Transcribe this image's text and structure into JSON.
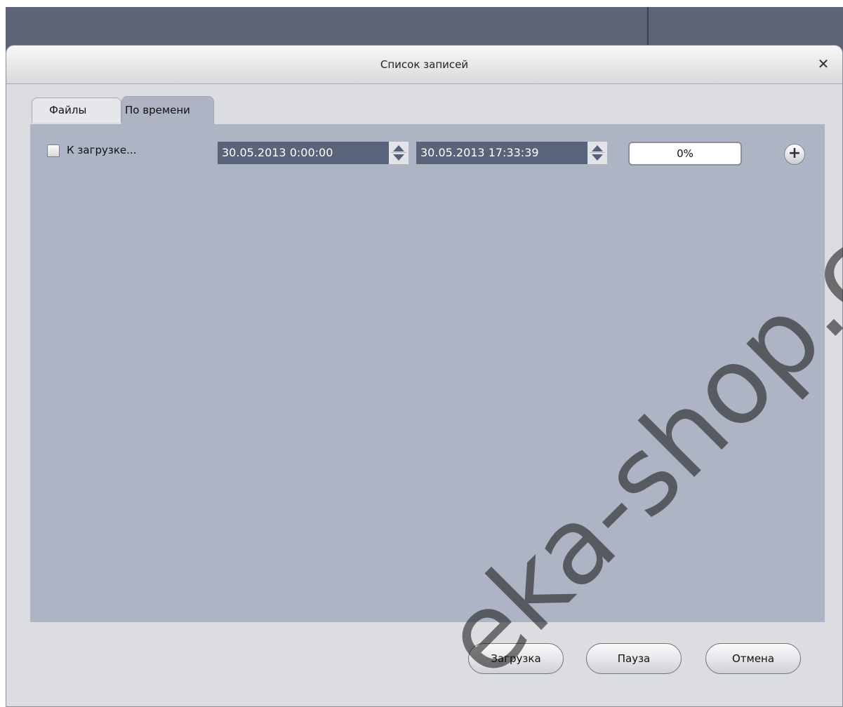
{
  "dialog": {
    "title": "Список записей",
    "close_glyph": "✕"
  },
  "tabs": [
    {
      "label": "Файлы",
      "active": false
    },
    {
      "label": "По времени",
      "active": true
    }
  ],
  "toolbar": {
    "checkbox_label": "К загрузке...",
    "checkbox_checked": false,
    "start_datetime": "30.05.2013 0:00:00",
    "end_datetime": "30.05.2013 17:33:39",
    "progress_text": "0%",
    "progress_value": 0,
    "add_icon": "plus-circle-icon",
    "add_glyph": "+"
  },
  "buttons": {
    "download": "Загрузка",
    "pause": "Пауза",
    "cancel": "Отмена"
  },
  "watermark": "eka-shop.com",
  "colors": {
    "app_background": "#5c6577",
    "panel": "#adb4c4",
    "datetime_field": "#59637a"
  }
}
